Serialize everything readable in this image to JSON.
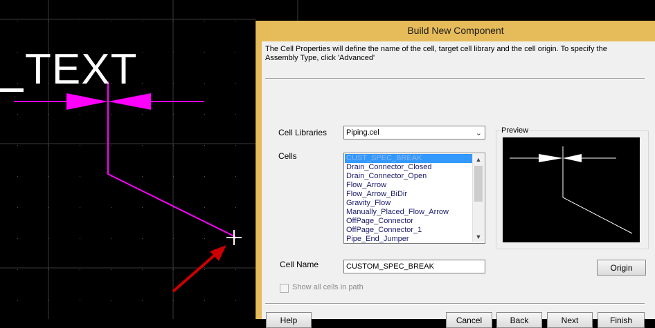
{
  "drawing": {
    "text": "TEXT"
  },
  "dialog": {
    "title": "Build New Component",
    "description": "The Cell Properties will define the name of the cell, target cell library and the cell origin.  To specify the Assembly Type, click 'Advanced'",
    "cell_libraries_label": "Cell Libraries",
    "cell_library_value": "Piping.cel",
    "cells_label": "Cells",
    "cells": [
      "CUST_SPEC_BREAK",
      "Drain_Connector_Closed",
      "Drain_Connector_Open",
      "Flow_Arrow",
      "Flow_Arrow_BiDir",
      "Gravity_Flow",
      "Manually_Placed_Flow_Arrow",
      "OffPage_Connector",
      "OffPage_Connector_1",
      "Pipe_End_Jumper"
    ],
    "selected_cell_index": 0,
    "preview_label": "Preview",
    "cell_name_label": "Cell Name",
    "cell_name_value": "CUSTOM_SPEC_BREAK",
    "show_all_label": "Show all cells in path",
    "show_all_checked": false,
    "buttons": {
      "origin": "Origin",
      "help": "Help",
      "cancel": "Cancel",
      "back": "Back",
      "next": "Next",
      "finish": "Finish"
    }
  },
  "colors": {
    "drawing_background": "#000000",
    "magenta_element": "#ff00ff",
    "annotation_arrow": "#cc0000",
    "title_bar": "#e6bb5a",
    "selection": "#3399ff"
  },
  "icons": {
    "dropdown": "chevron-down-icon",
    "scroll_up": "scroll-up-icon",
    "scroll_down": "scroll-down-icon",
    "cursor": "crosshair-cursor-icon"
  }
}
